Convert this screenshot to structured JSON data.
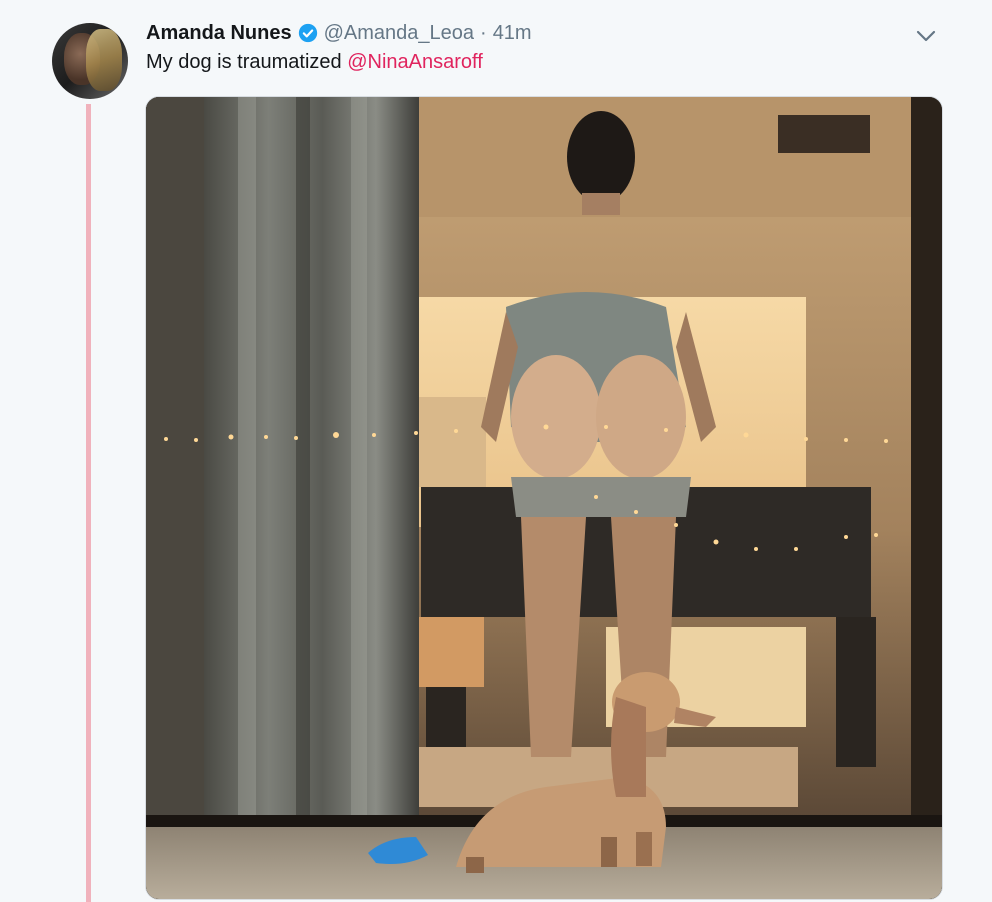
{
  "tweet": {
    "author_name": "Amanda Nunes",
    "handle": "@Amanda_Leoa",
    "separator": "·",
    "time": "41m",
    "text": "My dog is traumatized",
    "mention": "@NinaAnsaroff"
  },
  "icons": {
    "verified": "verified-badge-icon",
    "menu": "chevron-down-icon"
  },
  "colors": {
    "mention": "#e0245e",
    "verified": "#1da1f2",
    "thread_line": "#f0b2bc"
  }
}
